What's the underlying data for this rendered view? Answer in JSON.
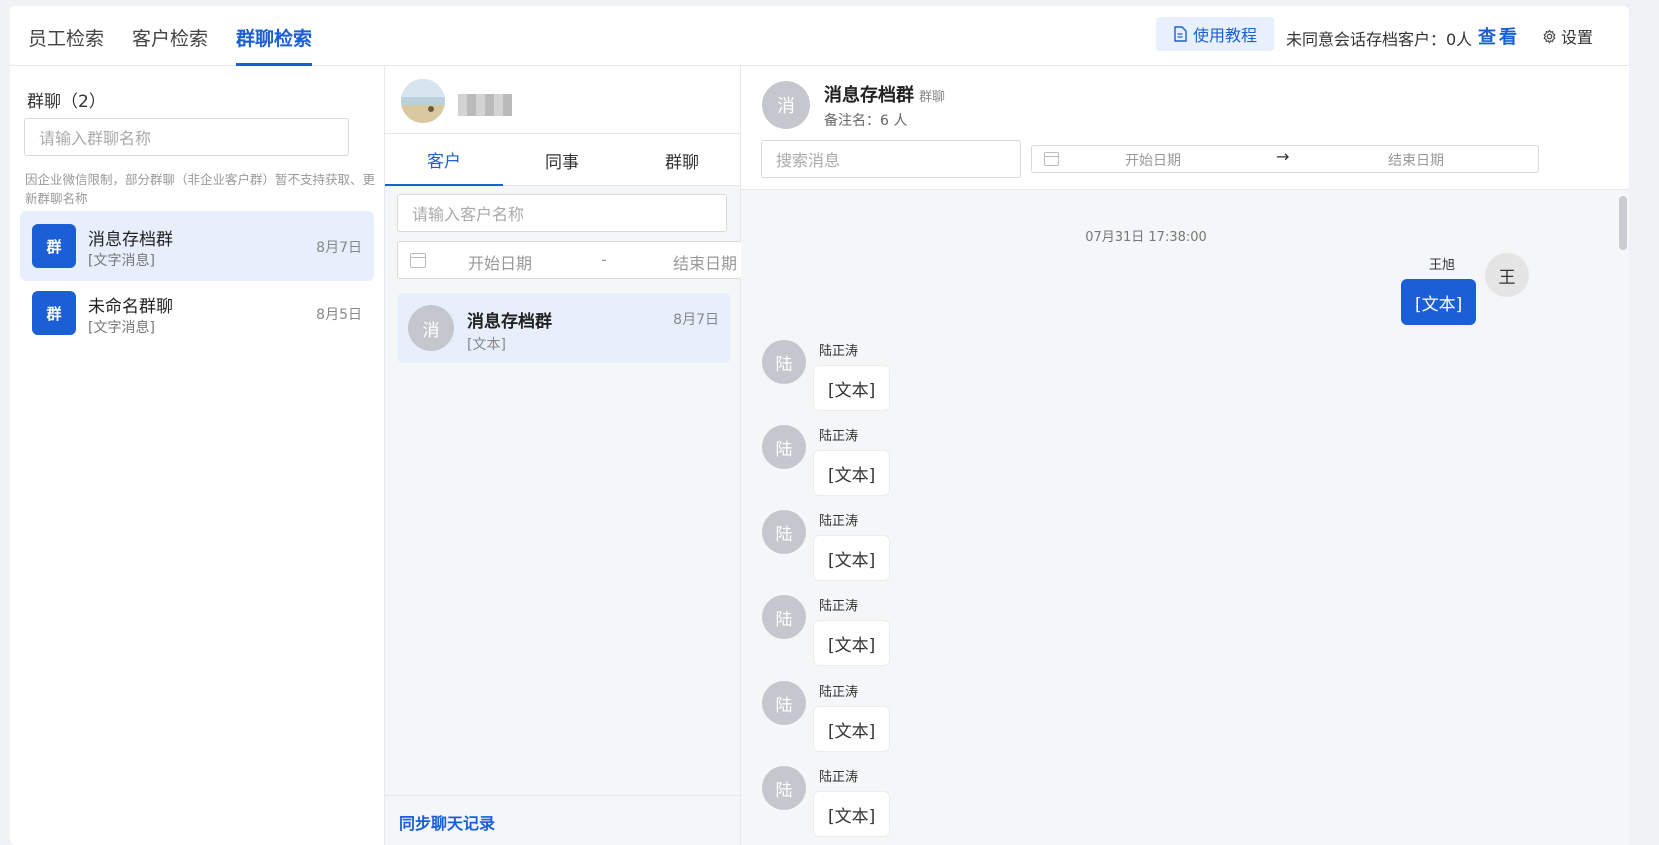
{
  "tabs": [
    {
      "label": "员工检索"
    },
    {
      "label": "客户检索"
    },
    {
      "label": "群聊检索"
    }
  ],
  "header": {
    "tutorial_label": "使用教程",
    "unconsent_text": "未同意会话存档客户：0人",
    "view_label": "查看",
    "settings_label": "设置"
  },
  "left": {
    "title": "群聊（2）",
    "search_placeholder": "请输入群聊名称",
    "notice": "因企业微信限制，部分群聊（非企业客户群）暂不支持获取、更新群聊名称",
    "groups": [
      {
        "avatar": "群",
        "name": "消息存档群",
        "sub": "[文字消息]",
        "date": "8月7日"
      },
      {
        "avatar": "群",
        "name": "未命名群聊",
        "sub": "[文字消息]",
        "date": "8月5日"
      }
    ]
  },
  "middle": {
    "tabs": [
      {
        "label": "客户"
      },
      {
        "label": "同事"
      },
      {
        "label": "群聊"
      }
    ],
    "search_placeholder": "请输入客户名称",
    "start_date": "开始日期",
    "separator": "-",
    "end_date": "结束日期",
    "chat": {
      "avatar": "消",
      "name": "消息存档群",
      "sub": "[文本]",
      "date": "8月7日"
    },
    "sync_label": "同步聊天记录"
  },
  "right": {
    "avatar": "消",
    "name": "消息存档群",
    "tag": "群聊",
    "remark": "备注名：6 人",
    "search_placeholder": "搜索消息",
    "start_date": "开始日期",
    "arrow": "→",
    "end_date": "结束日期",
    "timestamp": "07月31日 17:38:00",
    "self_message": {
      "avatar": "王",
      "sender": "王旭",
      "text": "[文本]"
    },
    "messages": [
      {
        "avatar": "陆",
        "sender": "陆正涛",
        "text": "[文本]"
      },
      {
        "avatar": "陆",
        "sender": "陆正涛",
        "text": "[文本]"
      },
      {
        "avatar": "陆",
        "sender": "陆正涛",
        "text": "[文本]"
      },
      {
        "avatar": "陆",
        "sender": "陆正涛",
        "text": "[文本]"
      },
      {
        "avatar": "陆",
        "sender": "陆正涛",
        "text": "[文本]"
      },
      {
        "avatar": "陆",
        "sender": "陆正涛",
        "text": "[文本]"
      }
    ]
  },
  "colors": {
    "accent": "#1a5fd6",
    "selected_bg": "#e8effc"
  }
}
